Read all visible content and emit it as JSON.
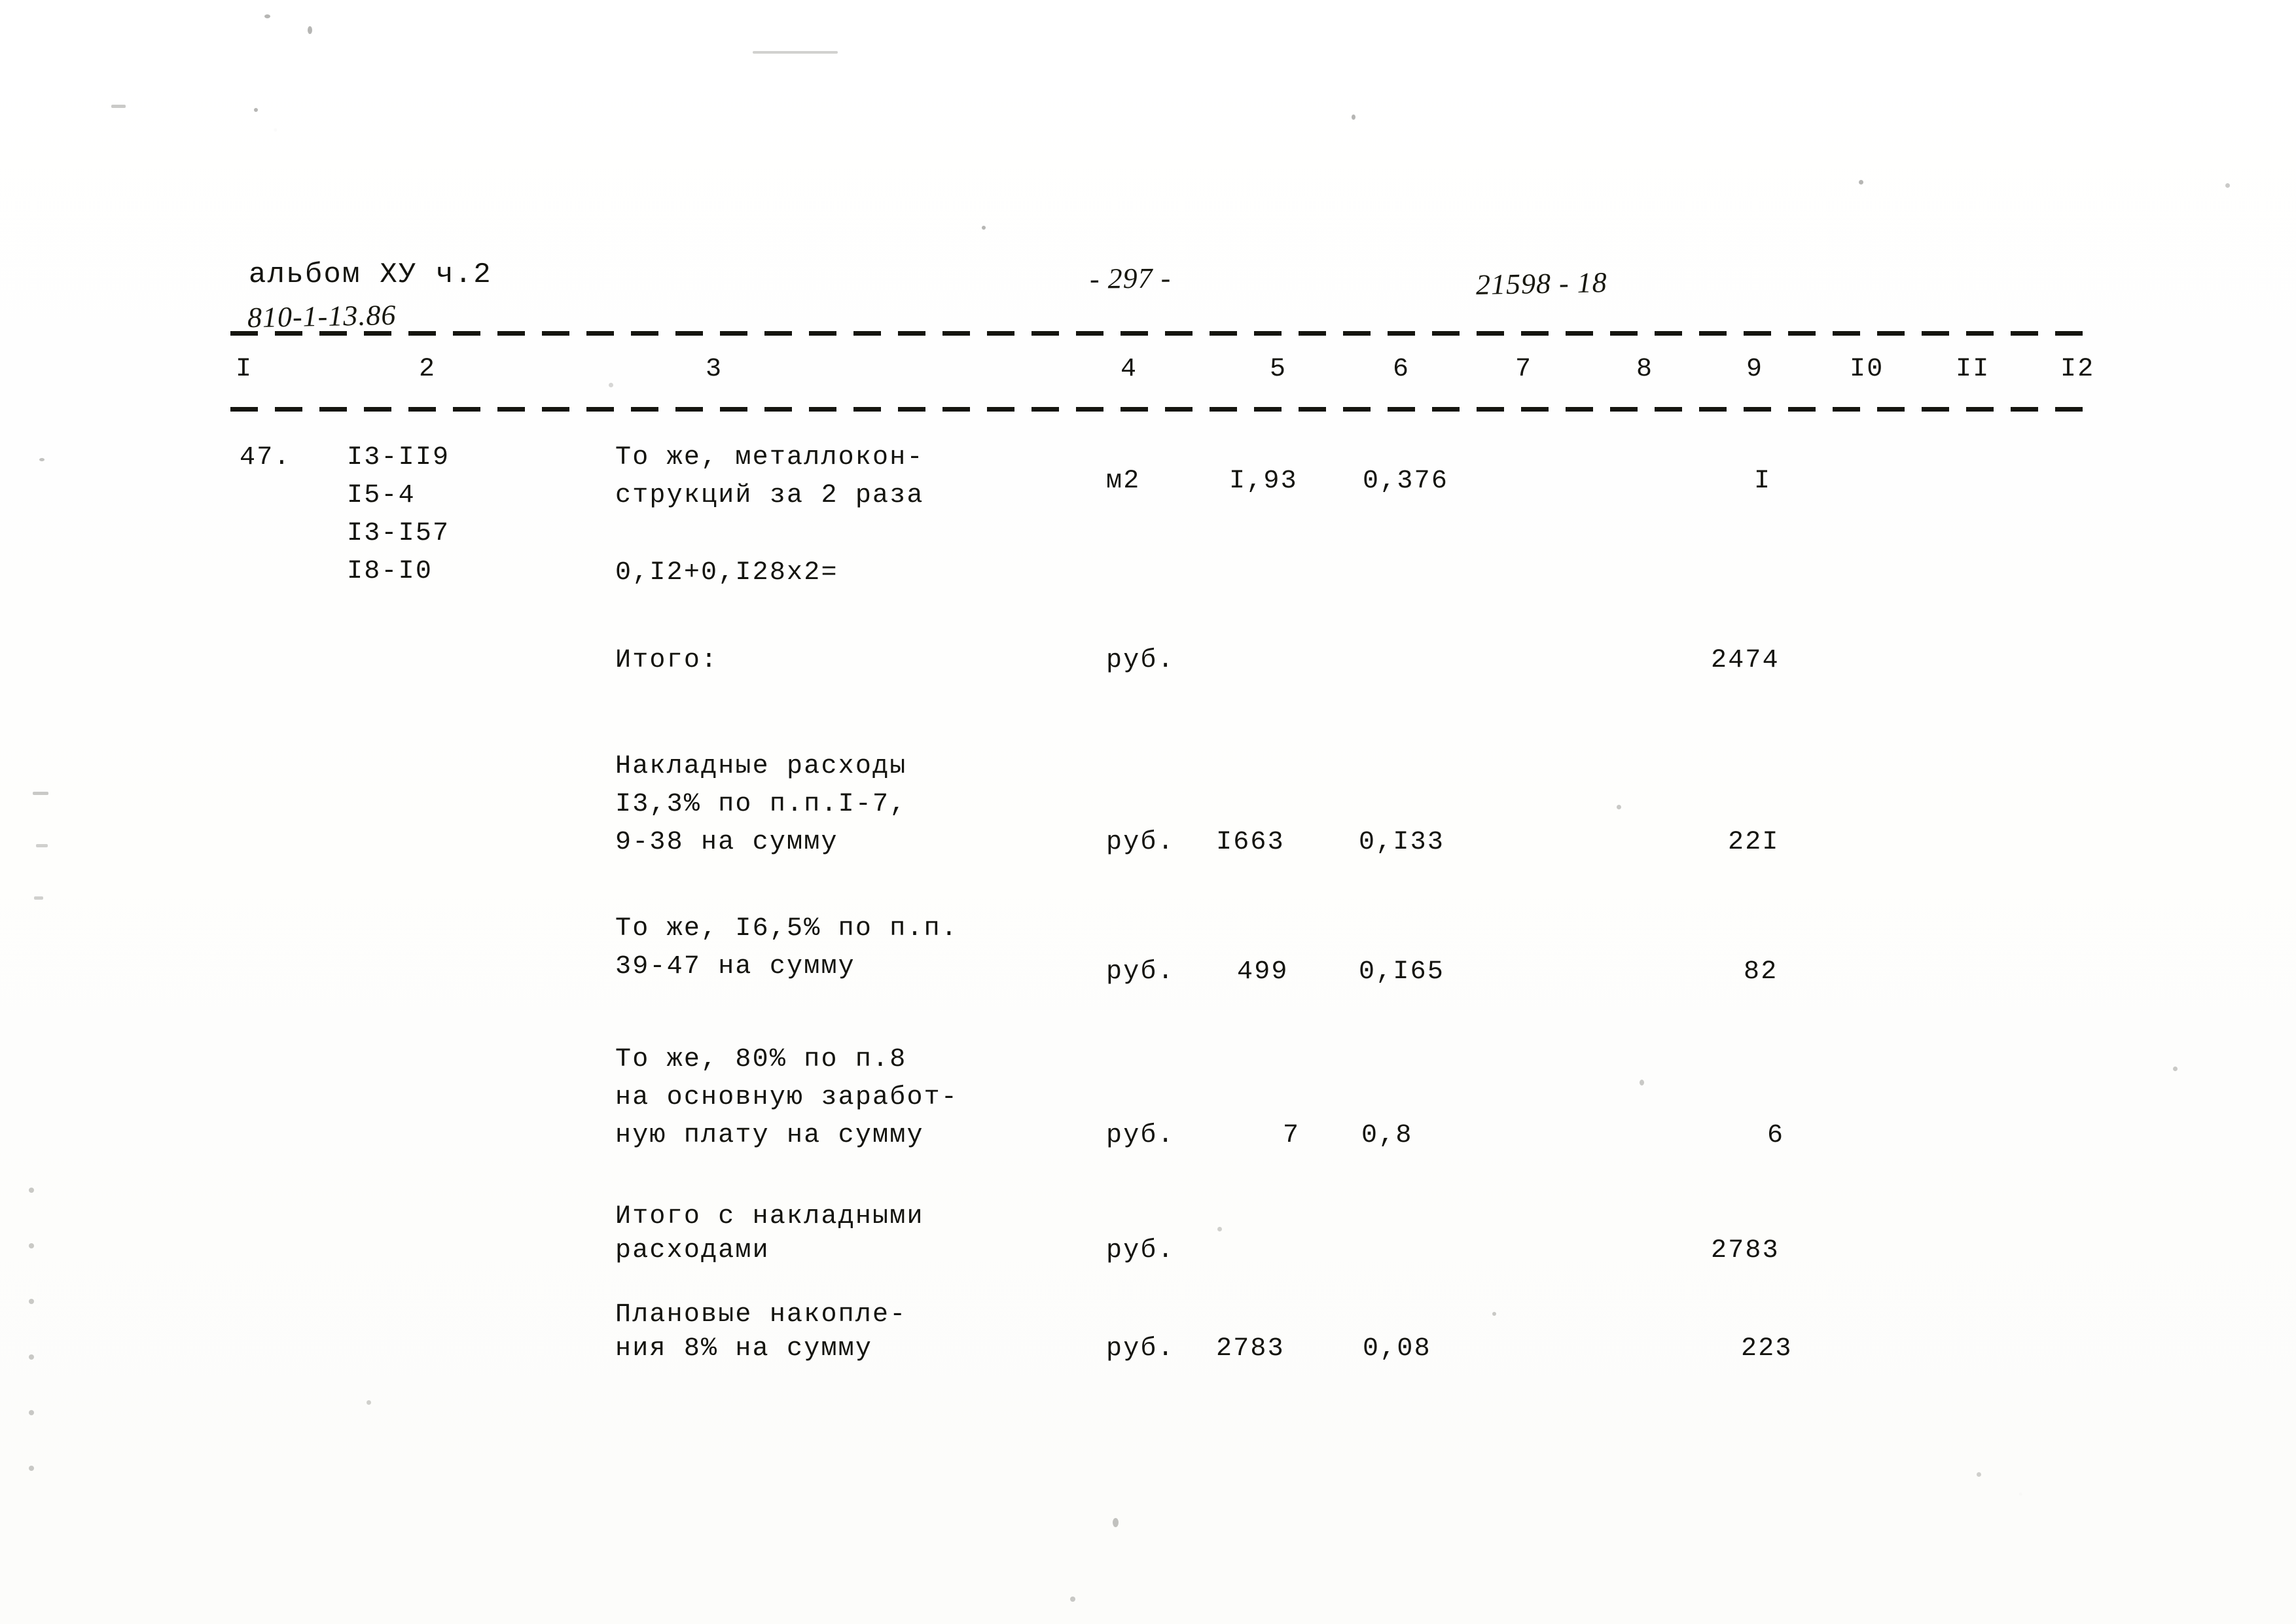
{
  "document": {
    "album_label": "альбом ХУ ч.2",
    "album_code": "810-1-13.86",
    "page_number": "- 297 -",
    "archive_code": "21598 - 18"
  },
  "table": {
    "column_headers": [
      "I",
      "2",
      "3",
      "4",
      "5",
      "6",
      "7",
      "8",
      "9",
      "I0",
      "II",
      "I2"
    ],
    "rows": [
      {
        "num": "47.",
        "codes": [
          "I3-II9",
          "I5-4",
          "I3-I57",
          "I8-I0"
        ],
        "description_lines": [
          "То же, металлокон-",
          "струкций за 2 раза"
        ],
        "formula": "0,I2+0,I28x2=",
        "unit": "м2",
        "col5": "I,93",
        "col6": "0,376",
        "col7": "",
        "col8": "",
        "col9": "I"
      },
      {
        "num": "",
        "codes": [],
        "description_lines": [
          "Итого:"
        ],
        "formula": "",
        "unit": "руб.",
        "col5": "",
        "col6": "",
        "col7": "",
        "col8": "",
        "col9": "2474"
      },
      {
        "num": "",
        "codes": [],
        "description_lines": [
          "Накладные расходы",
          "I3,3% по п.п.I-7,",
          "9-38 на сумму"
        ],
        "formula": "",
        "unit": "руб.",
        "col5": "I663",
        "col6": "0,I33",
        "col7": "",
        "col8": "",
        "col9": "22I"
      },
      {
        "num": "",
        "codes": [],
        "description_lines": [
          "То же, I6,5% по п.п.",
          "39-47 на сумму"
        ],
        "formula": "",
        "unit": "руб.",
        "col5": "499",
        "col6": "0,I65",
        "col7": "",
        "col8": "",
        "col9": "82"
      },
      {
        "num": "",
        "codes": [],
        "description_lines": [
          "То же, 80% по п.8",
          "на основную заработ-",
          "ную плату на сумму"
        ],
        "formula": "",
        "unit": "руб.",
        "col5": "7",
        "col6": "0,8",
        "col7": "",
        "col8": "",
        "col9": "6"
      },
      {
        "num": "",
        "codes": [],
        "description_lines": [
          "Итого с накладными",
          "расходами"
        ],
        "formula": "",
        "unit": "руб.",
        "col5": "",
        "col6": "",
        "col7": "",
        "col8": "",
        "col9": "2783"
      },
      {
        "num": "",
        "codes": [],
        "description_lines": [
          "Плановые накопле-",
          "ния 8% на сумму"
        ],
        "formula": "",
        "unit": "руб.",
        "col5": "2783",
        "col6": "0,08",
        "col7": "",
        "col8": "",
        "col9": "223"
      }
    ]
  }
}
